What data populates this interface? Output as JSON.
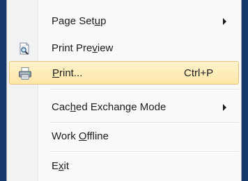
{
  "menu": {
    "items": [
      {
        "pre": "Page Set",
        "acc": "u",
        "post": "p",
        "shortcut": "",
        "submenu": true,
        "icon": ""
      },
      {
        "pre": "Print Pre",
        "acc": "v",
        "post": "iew",
        "shortcut": "",
        "submenu": false,
        "icon": "print-preview-icon"
      },
      {
        "pre": "",
        "acc": "P",
        "post": "rint...",
        "shortcut": "Ctrl+P",
        "submenu": false,
        "icon": "printer-icon",
        "highlighted": true
      },
      {
        "pre": "Cac",
        "acc": "h",
        "post": "ed Exchange Mode",
        "shortcut": "",
        "submenu": true,
        "icon": ""
      },
      {
        "pre": "Work ",
        "acc": "O",
        "post": "ffline",
        "shortcut": "",
        "submenu": false,
        "icon": ""
      },
      {
        "pre": "E",
        "acc": "x",
        "post": "it",
        "shortcut": "",
        "submenu": false,
        "icon": ""
      }
    ]
  },
  "colors": {
    "background": "#15386b",
    "menu_bg": "#fafafa",
    "highlight": "#fde7a8"
  }
}
